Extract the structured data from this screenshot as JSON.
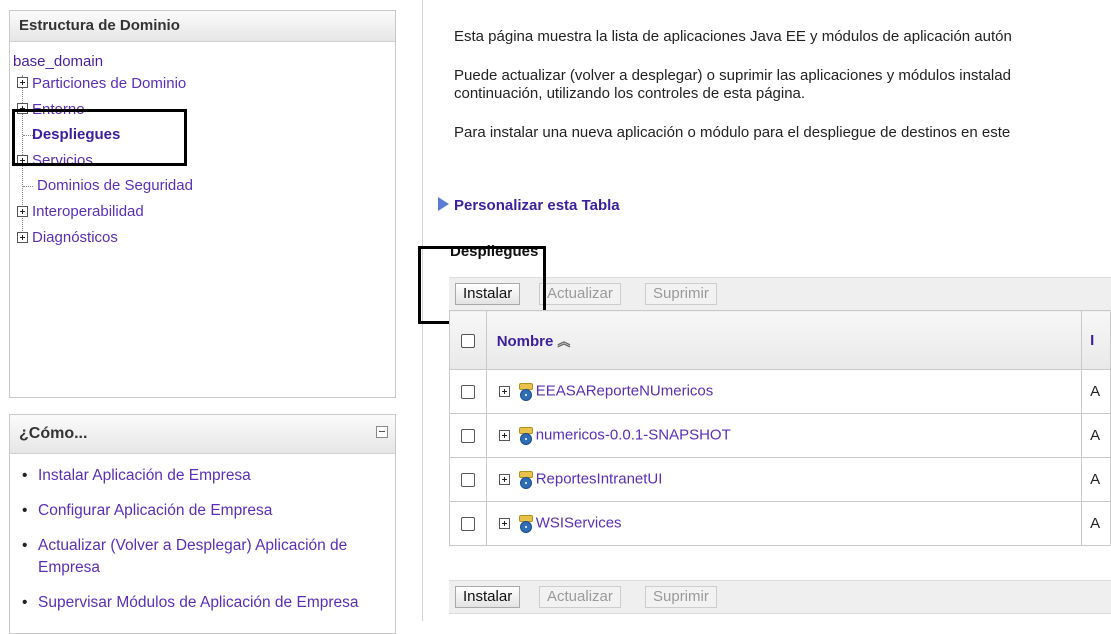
{
  "domain_panel": {
    "title": "Estructura de Dominio",
    "root": "base_domain",
    "nodes": [
      {
        "label": "Particiones de Dominio",
        "expandable": true
      },
      {
        "label": "Entorno",
        "expandable": true
      },
      {
        "label": "Despliegues",
        "expandable": false,
        "selected": true
      },
      {
        "label": "Servicios",
        "expandable": true
      },
      {
        "label": "Dominios de Seguridad",
        "expandable": false
      },
      {
        "label": "Interoperabilidad",
        "expandable": true
      },
      {
        "label": "Diagnósticos",
        "expandable": true
      }
    ]
  },
  "howto_panel": {
    "title": "¿Cómo...",
    "items": [
      "Instalar Aplicación de Empresa",
      "Configurar Aplicación de Empresa",
      "Actualizar (Volver a Desplegar) Aplicación de Empresa",
      "Supervisar Módulos de Aplicación de Empresa"
    ]
  },
  "main": {
    "intro_1": "Esta página muestra la lista de aplicaciones Java EE y módulos de aplicación autón",
    "intro_2a": "Puede actualizar (volver a desplegar) o suprimir las aplicaciones y módulos instalad",
    "intro_2b": "continuación, utilizando los controles de esta página.",
    "intro_3": "Para instalar una nueva aplicación o módulo para el despliegue de destinos en este",
    "customize_link": "Personalizar esta Tabla",
    "section_title": "Despliegues",
    "toolbar": {
      "install": "Instalar",
      "update": "Actualizar",
      "delete": "Suprimir"
    },
    "table": {
      "header_name": "Nombre",
      "header_next": "I",
      "rows": [
        {
          "name": "EEASAReporteNUmericos",
          "next": "A"
        },
        {
          "name": "numericos-0.0.1-SNAPSHOT",
          "next": "A"
        },
        {
          "name": "ReportesIntranetUI",
          "next": "A"
        },
        {
          "name": "WSIServices",
          "next": "A"
        }
      ]
    }
  }
}
